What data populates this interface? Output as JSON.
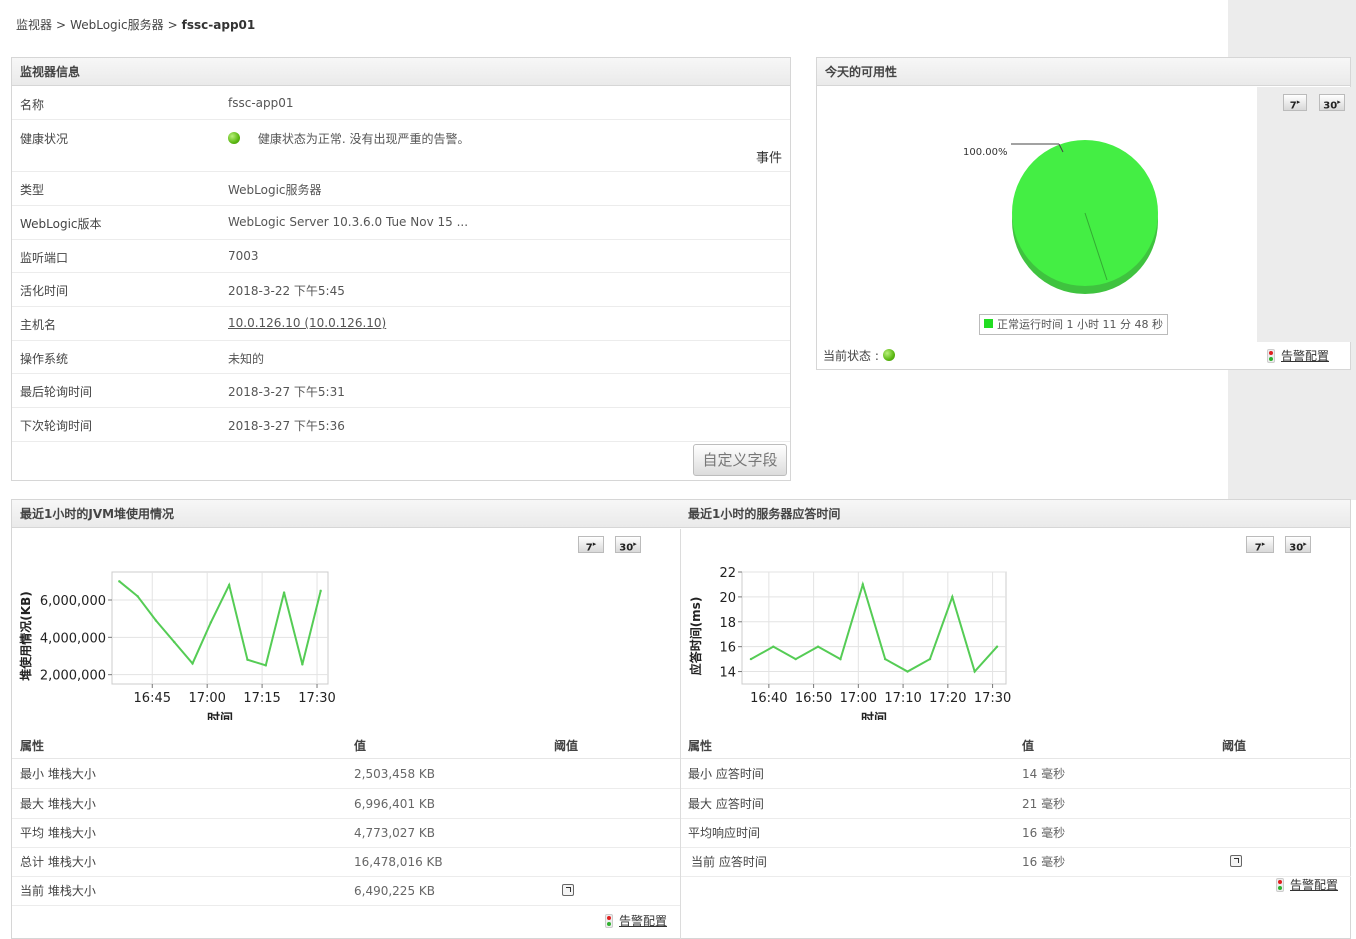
{
  "breadcrumb": {
    "item1": "监视器",
    "item2": "WebLogic服务器",
    "current": "fssc-app01",
    "separator": ">"
  },
  "monitor_info": {
    "title": "监视器信息",
    "rows": [
      {
        "label": "名称",
        "value": "fssc-app01"
      },
      {
        "label": "健康状况",
        "value": "健康状态为正常. 没有出现严重的告警。",
        "link": "事件"
      },
      {
        "label": "类型",
        "value": "WebLogic服务器"
      },
      {
        "label": "WebLogic版本",
        "value": "WebLogic Server 10.3.6.0 Tue Nov 15 ..."
      },
      {
        "label": "监听端口",
        "value": "7003"
      },
      {
        "label": "活化时间",
        "value": "2018-3-22 下午5:45"
      },
      {
        "label": "主机名",
        "value": "10.0.126.10 (10.0.126.10)"
      },
      {
        "label": "操作系统",
        "value": "未知的"
      },
      {
        "label": "最后轮询时间",
        "value": "2018-3-27 下午5:31"
      },
      {
        "label": "下次轮询时间",
        "value": "2018-3-27 下午5:36"
      }
    ],
    "custom_button": "自定义字段"
  },
  "availability": {
    "title": "今天的可用性",
    "btn7": "7",
    "btn30": "30",
    "percent_label": "100.00%",
    "legend": "正常运行时间 1 小时 11 分 48 秒",
    "current_status_label": "当前状态 :",
    "alarm_config": "告警配置",
    "pie_color": "#44ee44"
  },
  "jvm": {
    "title": "最近1小时的JVM堆使用情况",
    "btn7": "7",
    "btn30": "30",
    "attr_header": {
      "attr": "属性",
      "value": "值",
      "threshold": "阈值"
    },
    "rows": [
      {
        "attr": "最小 堆栈大小",
        "value": "2,503,458 KB"
      },
      {
        "attr": "最大 堆栈大小",
        "value": "6,996,401 KB"
      },
      {
        "attr": "平均 堆栈大小",
        "value": "4,773,027 KB"
      },
      {
        "attr": "总计 堆栈大小",
        "value": "16,478,016 KB"
      },
      {
        "attr": "当前 堆栈大小",
        "value": "6,490,225 KB"
      }
    ],
    "alarm_config": "告警配置"
  },
  "response": {
    "title": "最近1小时的服务器应答时间",
    "btn7": "7",
    "btn30": "30",
    "attr_header": {
      "attr": "属性",
      "value": "值",
      "threshold": "阈值"
    },
    "rows": [
      {
        "attr": "最小 应答时间",
        "value": "14 毫秒"
      },
      {
        "attr": "最大 应答时间",
        "value": "21 毫秒"
      },
      {
        "attr": "平均响应时间",
        "value": "16 毫秒"
      },
      {
        "attr": "当前 应答时间",
        "value": "16 毫秒"
      }
    ],
    "alarm_config": "告警配置"
  },
  "chart_data": [
    {
      "type": "line",
      "title": "",
      "xlabel": "时间",
      "ylabel": "堆使用情况(KB)",
      "x": [
        "16:36",
        "16:41",
        "16:46",
        "16:51",
        "16:56",
        "17:01",
        "17:06",
        "17:11",
        "17:16",
        "17:21",
        "17:26",
        "17:31"
      ],
      "values": [
        7000000,
        6200000,
        4900000,
        3750000,
        2600000,
        4800000,
        6800000,
        2800000,
        2500000,
        6400000,
        2550000,
        6490225
      ],
      "ylim": [
        1500000,
        7500000
      ],
      "yticks": [
        "2,000,000",
        "4,000,000",
        "6,000,000"
      ],
      "ytick_values": [
        2000000,
        4000000,
        6000000
      ],
      "xticks": [
        "16:45",
        "17:00",
        "17:15",
        "17:30"
      ],
      "xtick_values": [
        "16:45",
        "17:00",
        "17:15",
        "17:30"
      ],
      "color": "#55cc55"
    },
    {
      "type": "line",
      "title": "",
      "xlabel": "时间",
      "ylabel": "应答时间(ms)",
      "x": [
        "16:36",
        "16:41",
        "16:46",
        "16:51",
        "16:56",
        "17:01",
        "17:06",
        "17:11",
        "17:16",
        "17:21",
        "17:26",
        "17:31"
      ],
      "values": [
        15,
        16,
        15,
        16,
        15,
        21,
        15,
        14,
        15,
        20,
        14,
        16
      ],
      "ylim": [
        13,
        22
      ],
      "yticks": [
        "14",
        "16",
        "18",
        "20",
        "22"
      ],
      "ytick_values": [
        14,
        16,
        18,
        20,
        22
      ],
      "xticks": [
        "16:40",
        "16:50",
        "17:00",
        "17:10",
        "17:20",
        "17:30"
      ],
      "xtick_values": [
        "16:40",
        "16:50",
        "17:00",
        "17:10",
        "17:20",
        "17:30"
      ],
      "color": "#55cc55"
    }
  ]
}
